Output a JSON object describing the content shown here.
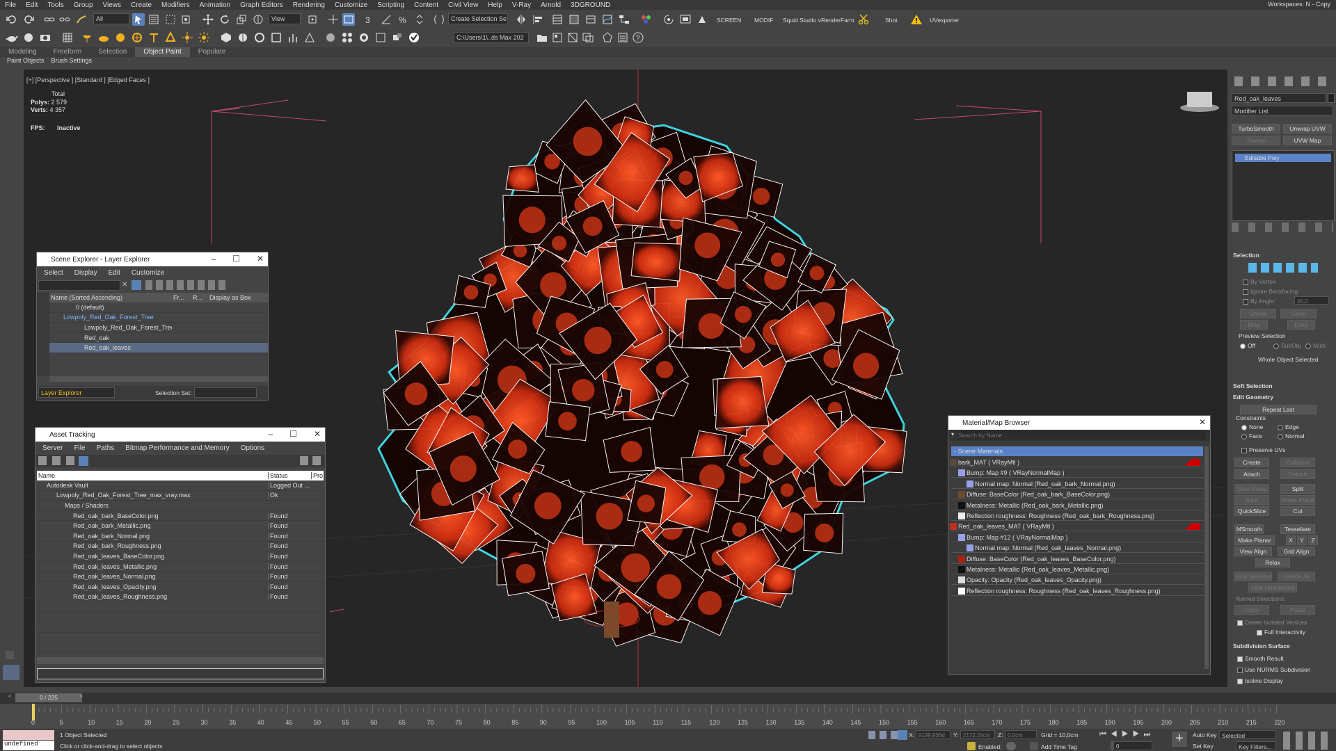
{
  "menu": [
    "File",
    "Edit",
    "Tools",
    "Group",
    "Views",
    "Create",
    "Modifiers",
    "Animation",
    "Graph Editors",
    "Rendering",
    "Customize",
    "Scripting",
    "Content",
    "Civil View",
    "Help",
    "V-Ray",
    "Arnold",
    "3DGROUND"
  ],
  "workspace": "Workspaces:  N - Copy",
  "toolbar": {
    "filter_all": "All",
    "view_dropdown": "View",
    "selection_set": "Create Selection Se",
    "screen": "SCREEN",
    "modif": "MODIF",
    "squid": "Squid Studio v",
    "renderfarm": "RenderFarm",
    "shot": "Shot",
    "uvexporter": "UVexporter",
    "path": "C:\\Users\\1\\..ds Max 202"
  },
  "ribbon_tabs": [
    "Modeling",
    "Freeform",
    "Selection",
    "Object Paint",
    "Populate"
  ],
  "ribbon_active": "Object Paint",
  "subribbon": [
    "Paint Objects",
    "Brush Settings"
  ],
  "viewport": {
    "label": "[+] [Perspective ] [Standard ] [Edged Faces ]",
    "total": "Total",
    "polys_label": "Polys:",
    "polys": "2 579",
    "verts_label": "Verts:",
    "verts": "4 357",
    "fps_label": "FPS:",
    "fps": "Inactive"
  },
  "scene_explorer": {
    "title": "Scene Explorer - Layer Explorer",
    "menu": [
      "Select",
      "Display",
      "Edit",
      "Customize"
    ],
    "columns": [
      "Name (Sorted Ascending)",
      "Fr...",
      "R...",
      "Display as Box"
    ],
    "rows": [
      "0 (default)",
      "Lowpoly_Red_Oak_Forest_Tree",
      "Lowpoly_Red_Oak_Forest_Tree",
      "Red_oak",
      "Red_oak_leaves"
    ],
    "footer_label": "Layer Explorer",
    "selection_set_label": "Selection Set:"
  },
  "asset_tracking": {
    "title": "Asset Tracking",
    "menu": [
      "Server",
      "File",
      "Paths",
      "Bitmap Performance and Memory",
      "Options"
    ],
    "columns": [
      "Name",
      "Status",
      "Pro"
    ],
    "rows": [
      {
        "name": "Autodesk Vault",
        "status": "Logged Out ..."
      },
      {
        "name": "Lowpoly_Red_Oak_Forest_Tree_max_vray.max",
        "status": "Ok"
      },
      {
        "name": "Maps / Shaders",
        "status": ""
      },
      {
        "name": "Red_oak_bark_BaseColor.png",
        "status": "Found"
      },
      {
        "name": "Red_oak_bark_Metallic.png",
        "status": "Found"
      },
      {
        "name": "Red_oak_bark_Normal.png",
        "status": "Found"
      },
      {
        "name": "Red_oak_bark_Roughness.png",
        "status": "Found"
      },
      {
        "name": "Red_oak_leaves_BaseColor.png",
        "status": "Found"
      },
      {
        "name": "Red_oak_leaves_Metallic.png",
        "status": "Found"
      },
      {
        "name": "Red_oak_leaves_Normal.png",
        "status": "Found"
      },
      {
        "name": "Red_oak_leaves_Opacity.png",
        "status": "Found"
      },
      {
        "name": "Red_oak_leaves_Roughness.png",
        "status": "Found"
      }
    ]
  },
  "material_browser": {
    "title": "Material/Map Browser",
    "search_placeholder": "Search by Name ...",
    "section": "- Scene Materials",
    "items": [
      "bark_MAT  ( VRayMtl )",
      "Bump: Map #9  ( VRayNormalMap )",
      "Normal map: Normal (Red_oak_bark_Normal.png)",
      "Diffuse: BaseColor (Red_oak_bark_BaseColor.png)",
      "Metalness: Metallic (Red_oak_bark_Metallic.png)",
      "Reflection roughness: Roughness (Red_oak_bark_Roughness.png)",
      "Red_oak_leaves_MAT  ( VRayMtl )",
      "Bump: Map #12  ( VRayNormalMap )",
      "Normal map: Normal (Red_oak_leaves_Normal.png)",
      "Diffuse: BaseColor (Red_oak_leaves_BaseColor.png)",
      "Metalness: Metallic (Red_oak_leaves_Metallic.png)",
      "Opacity: Opacity (Red_oak_leaves_Opacity.png)",
      "Reflection roughness: Roughness (Red_oak_leaves_Roughness.png)"
    ]
  },
  "command_panel": {
    "object_name": "Red_oak_leaves",
    "modifier_list": "Modifier List",
    "btn_turbosmooth": "TurboSmooth",
    "btn_unwrap": "Unwrap UVW",
    "btn_sweep": "Sweep",
    "btn_uvwmap": "UVW Map",
    "stack_item": "Editable Poly",
    "selection_header": "Selection",
    "by_vertex": "By Vertex",
    "ignore_backfacing": "Ignore Backfacing",
    "by_angle": "By Angle:",
    "by_angle_val": "45,0",
    "shrink": "Shrink",
    "grow": "Grow",
    "ring": "Ring",
    "loop": "Loop",
    "preview_selection": "Preview Selection",
    "off": "Off",
    "subobj": "SubObj",
    "multi": "Multi",
    "whole_object": "Whole Object Selected",
    "soft_selection": "Soft Selection",
    "edit_geometry": "Edit Geometry",
    "repeat_last": "Repeat Last",
    "constraints": "Constraints",
    "none": "None",
    "edge": "Edge",
    "face": "Face",
    "normal": "Normal",
    "preserve_uvs": "Preserve UVs",
    "create": "Create",
    "collapse": "Collapse",
    "attach": "Attach",
    "detach": "Detach",
    "slice_plane": "Slice Plane",
    "split": "Split",
    "slice": "Slice",
    "reset_plane": "Reset Plane",
    "quickslice": "QuickSlice",
    "cut": "Cut",
    "msmooth": "MSmooth",
    "tessellate": "Tessellate",
    "make_planar": "Make Planar",
    "x": "X",
    "y": "Y",
    "z": "Z",
    "view_align": "View Align",
    "grid_align": "Grid Align",
    "relax": "Relax",
    "hide_selected": "Hide Selected",
    "unhide_all": "Unhide All",
    "hide_unselected": "Hide Unselected",
    "named_selections": "Named Selections:",
    "copy": "Copy",
    "paste": "Paste",
    "delete_isolated": "Delete Isolated Vertices",
    "full_interactivity": "Full Interactivity",
    "subdivision_surface": "Subdivision Surface",
    "smooth_result": "Smooth Result",
    "use_nurms": "Use NURMS Subdivision",
    "isoline": "Isoline Display"
  },
  "timeline": {
    "frame": "0 / 225",
    "ticks": [
      "0",
      "5",
      "10",
      "15",
      "20",
      "25",
      "30",
      "35",
      "40",
      "45",
      "50",
      "55",
      "60",
      "65",
      "70",
      "75",
      "80",
      "85",
      "90",
      "95",
      "100",
      "105",
      "110",
      "115",
      "120",
      "125",
      "130",
      "135",
      "140",
      "145",
      "150",
      "155",
      "160",
      "165",
      "170",
      "175",
      "180",
      "185",
      "190",
      "195",
      "200",
      "205",
      "210",
      "215",
      "220"
    ]
  },
  "status": {
    "maxscript": "undefined",
    "selected": "1 Object Selected",
    "prompt": "Click or click-and-drag to select objects",
    "x_label": "X:",
    "x": "9199,936d",
    "y_label": "Y:",
    "y": "2172,24cm",
    "z_label": "Z:",
    "z": "0,0cm",
    "grid": "Grid = 10,0cm",
    "enabled": "Enabled:",
    "add_time_tag": "Add Time Tag",
    "auto_key": "Auto Key",
    "set_key": "Set Key",
    "selected_dd": "Selected",
    "key_filters": "Key Filters...",
    "frame_field": "0"
  },
  "colors": {
    "accent": "#5a6a84",
    "selection_outline": "#3fd4e0",
    "leaf_red": "#e0401c"
  }
}
